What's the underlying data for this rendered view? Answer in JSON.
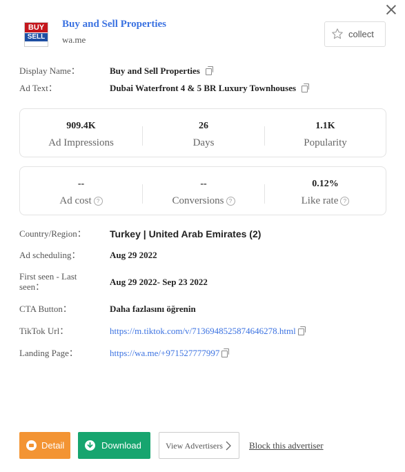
{
  "header": {
    "logo_top": "BUY",
    "logo_bottom": "SELL",
    "title": "Buy and Sell Properties",
    "subtitle": "wa.me",
    "collect_label": "collect"
  },
  "details": {
    "display_name_label": "Display Name：",
    "display_name_value": "Buy and Sell Properties",
    "ad_text_label": "Ad Text：",
    "ad_text_value": "Dubai Waterfront 4 & 5 BR Luxury Townhouses"
  },
  "stats_primary": [
    {
      "value": "909.4K",
      "label": "Ad Impressions"
    },
    {
      "value": "26",
      "label": "Days"
    },
    {
      "value": "1.1K",
      "label": "Popularity"
    }
  ],
  "stats_secondary": [
    {
      "value": "--",
      "label": "Ad cost"
    },
    {
      "value": "--",
      "label": "Conversions"
    },
    {
      "value": "0.12%",
      "label": "Like rate"
    }
  ],
  "info": {
    "country_label": "Country/Region：",
    "country_value": "Turkey | United Arab Emirates (2)",
    "scheduling_label": "Ad scheduling：",
    "scheduling_value": "Aug 29 2022",
    "seen_label": "First seen - Last seen：",
    "seen_value": "Aug 29 2022- Sep 23 2022",
    "cta_label": "CTA Button：",
    "cta_value": "Daha fazlasını öğrenin",
    "tiktok_label": "TikTok Url：",
    "tiktok_value": "https://m.tiktok.com/v/7136948525874646278.html",
    "landing_label": "Landing Page：",
    "landing_value": "https://wa.me/+971527777997"
  },
  "actions": {
    "detail_label": "Detail",
    "download_label": "Download",
    "view_advertisers_label": "View Advertisers",
    "block_label": "Block this advertiser"
  },
  "colors": {
    "accent": "#3b72e1",
    "detail": "#f39433",
    "download": "#17a56f"
  }
}
